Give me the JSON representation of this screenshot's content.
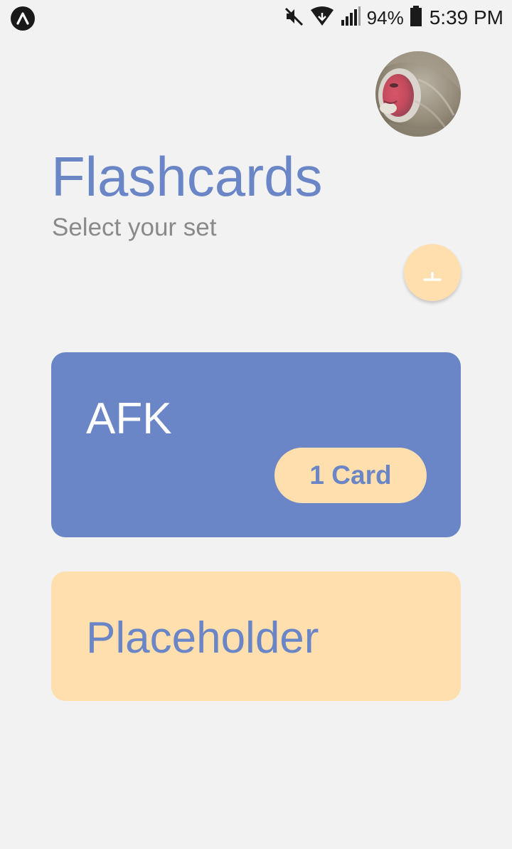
{
  "status_bar": {
    "battery_percent": "94%",
    "time": "5:39 PM",
    "icons": [
      "app-indicator-icon",
      "mute-icon",
      "wifi-icon",
      "signal-icon",
      "battery-icon"
    ]
  },
  "header": {
    "title": "Flashcards",
    "subtitle": "Select your set"
  },
  "actions": {
    "add_icon": "plus-icon"
  },
  "sets": [
    {
      "title": "AFK",
      "count_label": "1 Card"
    },
    {
      "title": "Placeholder"
    }
  ],
  "colors": {
    "primary": "#6a86c6",
    "accent": "#fedfad",
    "background": "#f2f2f2",
    "subtitle": "#8a8a8a"
  }
}
